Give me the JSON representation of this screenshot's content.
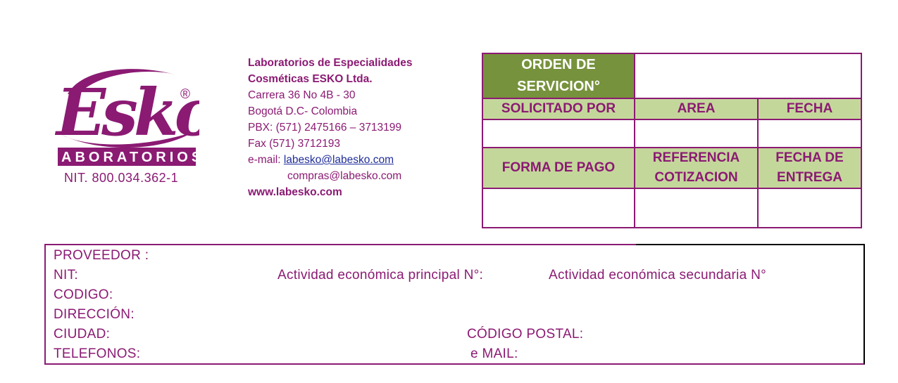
{
  "logo": {
    "wordmark": "Esko",
    "registered_mark": "®",
    "subtitle": "LABORATORIOS",
    "brand_color": "#8b1a73"
  },
  "nit": "NIT. 800.034.362-1",
  "company": {
    "name_line1": "Laboratorios de Especialidades",
    "name_line2": "Cosméticas ESKO Ltda.",
    "address": "Carrera 36 No 4B - 30",
    "city": "Bogotá D.C- Colombia",
    "pbx": "PBX: (571) 2475166 – 3713199",
    "fax": "Fax (571) 3712193",
    "email_label": "e-mail: ",
    "email1": "labesko@labesko.com",
    "email2": "compras@labesko.com",
    "website": "www.labesko.com"
  },
  "order_table": {
    "title": "ORDEN DE SERVICION°",
    "headers1": [
      "SOLICITADO POR",
      "AREA",
      "FECHA"
    ],
    "headers2": [
      "FORMA DE PAGO",
      "REFERENCIA COTIZACION",
      "FECHA DE ENTREGA"
    ],
    "colors": {
      "title_bg": "#76923c",
      "header_bg": "#c4d79b"
    }
  },
  "supplier": {
    "proveedor": "PROVEEDOR :",
    "nit": "NIT:",
    "actividad_principal": "Actividad económica principal N°:",
    "actividad_secundaria": "Actividad económica secundaria N°",
    "codigo": "CODIGO:",
    "direccion": "DIRECCIÓN:",
    "ciudad": "CIUDAD:",
    "codigo_postal": "CÓDIGO POSTAL:",
    "telefonos": "TELEFONOS:",
    "email": "e MAIL:"
  }
}
